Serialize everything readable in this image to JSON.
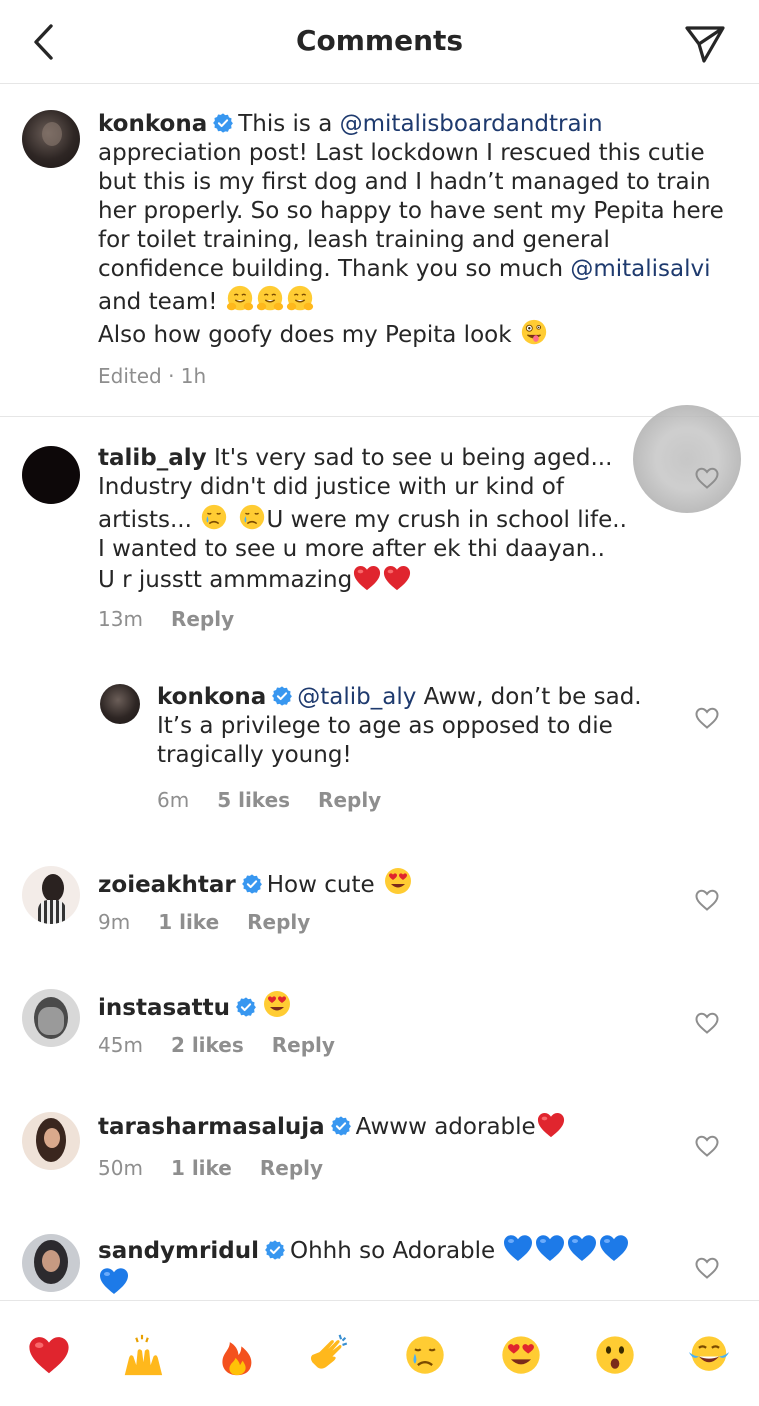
{
  "header": {
    "title": "Comments",
    "back_icon": "chevron-left-icon",
    "send_icon": "paper-plane-icon"
  },
  "caption": {
    "username": "konkona",
    "text_before": "This is a ",
    "mention1": "@mitalisboardandtrain",
    "text_middle": " appreciation post! Last lockdown I rescued this cutie but this is my first dog and I hadn’t managed to train her properly. So so happy to have sent my Pepita here for toilet training, leash training and general confidence building. Thank you so much ",
    "mention2": "@mitalisalvi",
    "text_after": " and team! ",
    "line2": "Also how goofy does my Pepita look ",
    "meta": "Edited · 1h"
  },
  "comments": [
    {
      "username": "talib_aly",
      "text1": "It's very sad to see u being aged... Industry didn't did justice with ur kind of artists... ",
      "text2": "U were my crush in school life.. I wanted to see u more after ek thi daayan.. U r jusstt ammmazing",
      "time": "13m",
      "reply": "Reply"
    },
    {
      "username": "konkona",
      "mention": "@talib_aly",
      "text": " Aww, don’t be sad. It’s a privilege to age as opposed to die tragically young!",
      "time": "6m",
      "likes": "5 likes",
      "reply": "Reply"
    },
    {
      "username": "zoieakhtar",
      "text": "How cute ",
      "time": "9m",
      "likes": "1 like",
      "reply": "Reply"
    },
    {
      "username": "instasattu",
      "text": "",
      "time": "45m",
      "likes": "2 likes",
      "reply": "Reply"
    },
    {
      "username": "tarasharmasaluja",
      "text": "Awww adorable",
      "time": "50m",
      "likes": "1 like",
      "reply": "Reply"
    },
    {
      "username": "sandymridul",
      "text": "Ohhh so Adorable "
    }
  ],
  "emoji_bar": [
    "red-heart",
    "raising-hands",
    "fire",
    "clapping-hands",
    "crying-face",
    "heart-eyes-face",
    "surprised-face",
    "tears-of-joy-face"
  ],
  "colors": {
    "verified": "#3897f0",
    "mention": "#1e3a6e",
    "meta": "#8e8e8e",
    "heart_red": "#e0252e",
    "heart_blue": "#1d7ae8"
  }
}
